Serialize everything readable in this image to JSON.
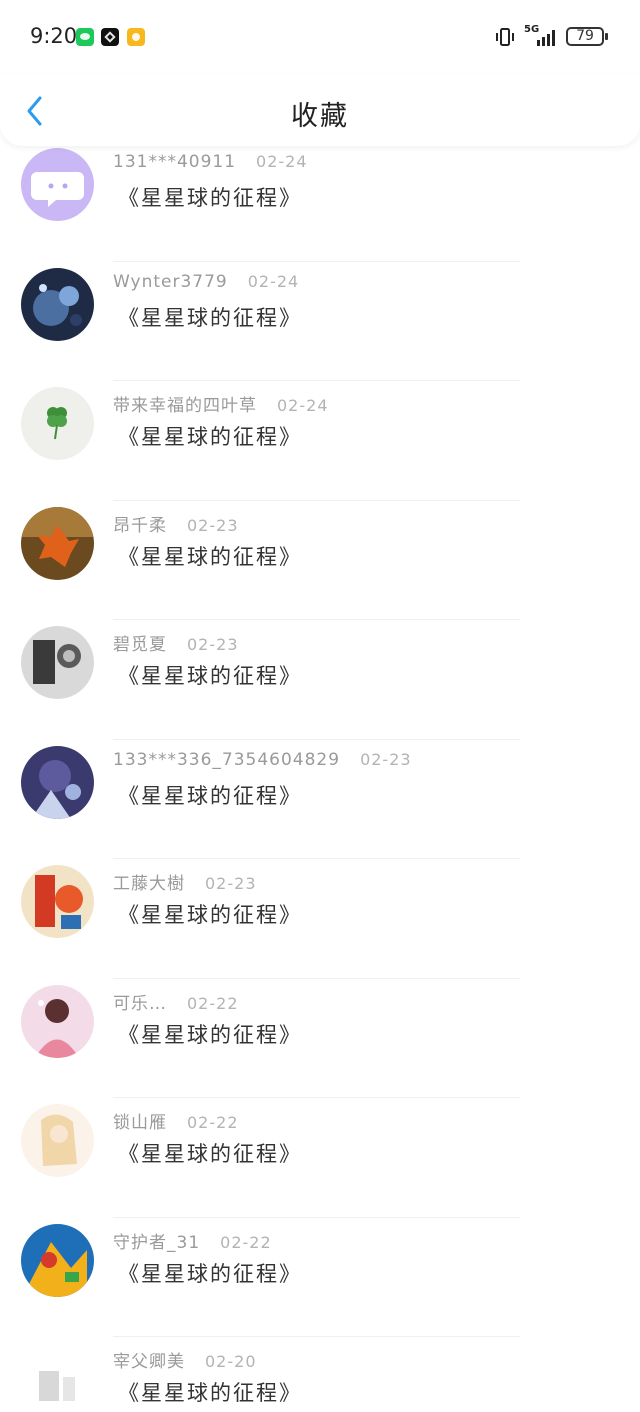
{
  "status_bar": {
    "time": "9:20",
    "network": "5G",
    "battery": "79",
    "app_icons": [
      "wechat-icon",
      "capcut-icon",
      "notes-icon"
    ]
  },
  "header": {
    "back_icon": "chevron-left-icon",
    "title": "收藏"
  },
  "colors": {
    "accent": "#2a9bef",
    "text_primary": "#333333",
    "text_secondary": "#9a9a9a"
  },
  "items": [
    {
      "user": "131***40911",
      "date": "02-24",
      "title": "《星星球的征程》",
      "avatar": "chat-bubble-avatar"
    },
    {
      "user": "Wynter3779",
      "date": "02-24",
      "title": "《星星球的征程》",
      "avatar": "user-avatar"
    },
    {
      "user": "带来幸福的四叶草",
      "date": "02-24",
      "title": "《星星球的征程》",
      "avatar": "clover-avatar"
    },
    {
      "user": "昂千柔",
      "date": "02-23",
      "title": "《星星球的征程》",
      "avatar": "leaf-avatar"
    },
    {
      "user": "碧觅夏",
      "date": "02-23",
      "title": "《星星球的征程》",
      "avatar": "user-avatar"
    },
    {
      "user": "133***336_7354604829",
      "date": "02-23",
      "title": "《星星球的征程》",
      "avatar": "anime-avatar"
    },
    {
      "user": "工藤大樹",
      "date": "02-23",
      "title": "《星星球的征程》",
      "avatar": "anime-avatar"
    },
    {
      "user": "可乐…",
      "date": "02-22",
      "title": "《星星球的征程》",
      "avatar": "anime-avatar"
    },
    {
      "user": "锁山雁",
      "date": "02-22",
      "title": "《星星球的征程》",
      "avatar": "anime-avatar"
    },
    {
      "user": "守护者_31",
      "date": "02-22",
      "title": "《星星球的征程》",
      "avatar": "anime-avatar"
    },
    {
      "user": "宰父卿美",
      "date": "02-20",
      "title": "《星星球的征程》",
      "avatar": "user-avatar"
    }
  ]
}
